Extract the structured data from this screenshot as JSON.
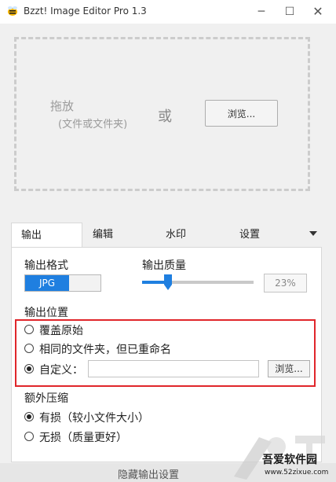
{
  "window": {
    "title": "Bzzt! Image Editor Pro 1.3",
    "controls": {
      "minimize": "─",
      "maximize": "☐",
      "close": "✕"
    }
  },
  "dropzone": {
    "drag_label": "拖放",
    "drag_sub": "(文件或文件夹)",
    "or_label": "或",
    "browse_label": "浏览..."
  },
  "tabs": [
    {
      "label": "输出",
      "active": true
    },
    {
      "label": "编辑",
      "active": false
    },
    {
      "label": "水印",
      "active": false
    },
    {
      "label": "设置",
      "active": false
    }
  ],
  "output": {
    "format_label": "输出格式",
    "format_value": "JPG",
    "quality_label": "输出质量",
    "quality_value": "23%",
    "quality_fraction": 0.23,
    "location_label": "输出位置",
    "location_options": [
      {
        "label": "覆盖原始",
        "checked": false
      },
      {
        "label": "相同的文件夹，但已重命名",
        "checked": false
      },
      {
        "label": "自定义：",
        "checked": true
      }
    ],
    "custom_path_value": "",
    "custom_browse_label": "浏览...",
    "compression_label": "额外压缩",
    "compression_options": [
      {
        "label": "有损（较小文件大小）",
        "checked": true
      },
      {
        "label": "无损（质量更好）",
        "checked": false
      }
    ]
  },
  "footer": {
    "toggle_label": "隐藏输出设置"
  },
  "watermark": {
    "title": "吾爱软件园",
    "url": "www.52zixue.com"
  },
  "colors": {
    "accent": "#1f7fe0",
    "highlight": "#e0262b"
  },
  "icons": {
    "app": "bee-icon",
    "tab_menu": "chevron-down-icon",
    "slider_thumb": "slider-thumb-icon"
  }
}
